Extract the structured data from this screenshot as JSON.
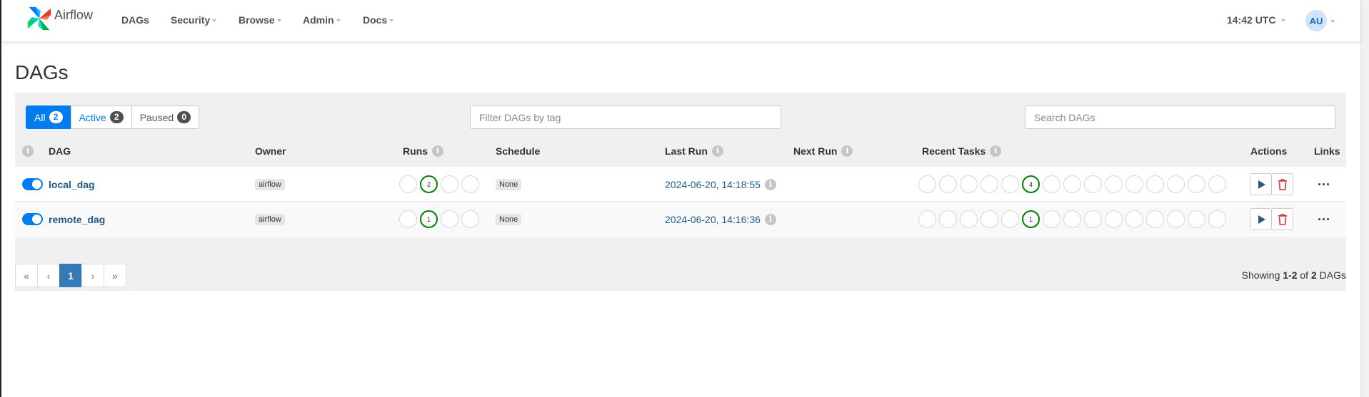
{
  "nav": {
    "brand": "Airflow",
    "items": [
      {
        "label": "DAGs",
        "dropdown": false
      },
      {
        "label": "Security",
        "dropdown": true
      },
      {
        "label": "Browse",
        "dropdown": true
      },
      {
        "label": "Admin",
        "dropdown": true
      },
      {
        "label": "Docs",
        "dropdown": true
      }
    ],
    "clock": "14:42 UTC",
    "user_initials": "AU"
  },
  "page": {
    "title": "DAGs"
  },
  "filters": {
    "all_label": "All",
    "all_count": "2",
    "active_label": "Active",
    "active_count": "2",
    "paused_label": "Paused",
    "paused_count": "0",
    "tag_placeholder": "Filter DAGs by tag",
    "search_placeholder": "Search DAGs"
  },
  "table": {
    "columns": {
      "dag": "DAG",
      "owner": "Owner",
      "runs": "Runs",
      "schedule": "Schedule",
      "last_run": "Last Run",
      "next_run": "Next Run",
      "recent_tasks": "Recent Tasks",
      "actions": "Actions",
      "links": "Links"
    },
    "rows": [
      {
        "name": "local_dag",
        "owner": "airflow",
        "runs_success": "2",
        "schedule": "None",
        "last_run": "2024-06-20, 14:18:55",
        "tasks_success": "4",
        "active": true
      },
      {
        "name": "remote_dag",
        "owner": "airflow",
        "runs_success": "1",
        "schedule": "None",
        "last_run": "2024-06-20, 14:16:36",
        "tasks_success": "1",
        "active": true
      }
    ]
  },
  "pagination": {
    "first": "«",
    "prev": "‹",
    "current": "1",
    "next": "›",
    "last": "»",
    "showing_prefix": "Showing ",
    "showing_range": "1-2",
    "showing_of": " of ",
    "showing_total": "2",
    "showing_suffix": " DAGs"
  },
  "colors": {
    "accent": "#017cee",
    "success": "#008000",
    "link": "#1f5c8b"
  }
}
